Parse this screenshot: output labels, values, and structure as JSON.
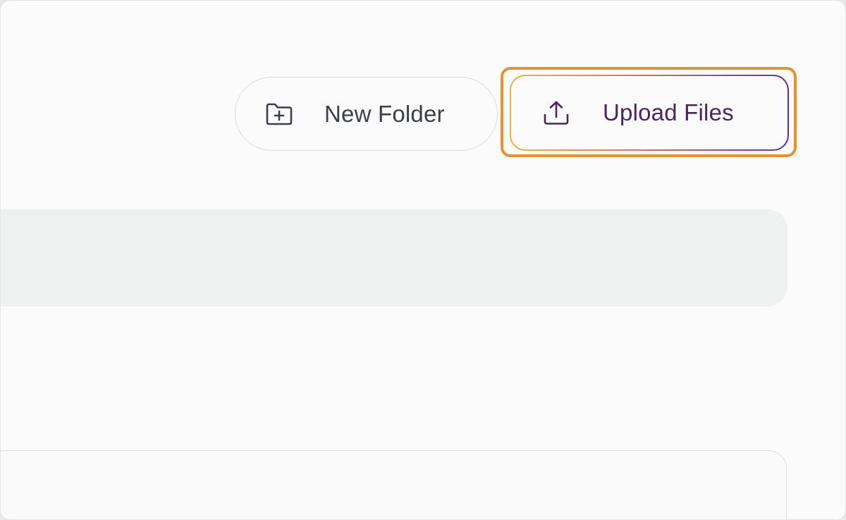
{
  "toolbar": {
    "new_folder_label": "New Folder",
    "new_folder_icon": "folder-plus-icon",
    "upload_files_label": "Upload Files",
    "upload_files_icon": "upload-icon"
  },
  "colors": {
    "highlight": "#e9912d",
    "upload_text": "#4a2563",
    "upload_border_start": "#f0b437",
    "upload_border_end": "#6b2e8c",
    "panel_bg": "#eff0f0"
  }
}
